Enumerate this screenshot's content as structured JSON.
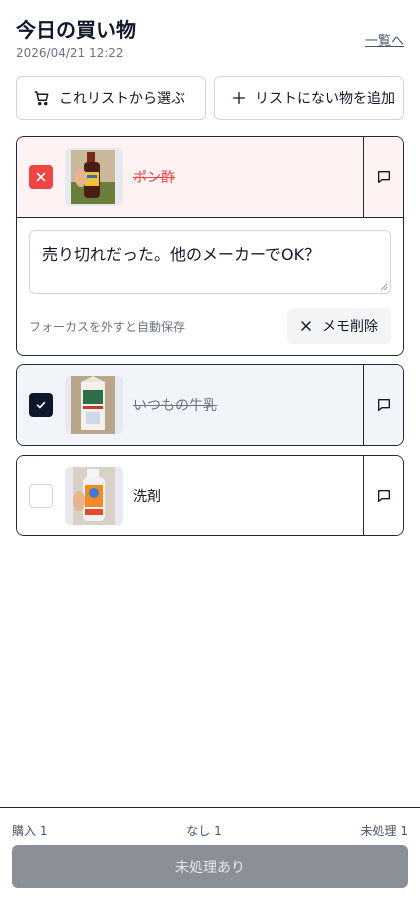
{
  "header": {
    "title": "今日の買い物",
    "datetime": "2026/04/21 12:22",
    "list_link": "一覧へ"
  },
  "actions": {
    "pick_label": "これリストから選ぶ",
    "pick_icon": "cart-icon",
    "add_label": "リストにない物を追加",
    "add_icon": "plus-icon"
  },
  "items": [
    {
      "name": "ポン酢",
      "status": "skip",
      "status_color": "#ef4444",
      "memo_open": true,
      "memo": {
        "text": "売り切れだった。他のメーカーでOK？",
        "hint": "フォーカスを外すと自動保存",
        "delete_label": "メモ削除"
      }
    },
    {
      "name": "いつもの牛乳",
      "status": "bought",
      "status_color": "#0f172a",
      "memo_open": false
    },
    {
      "name": "洗剤",
      "status": "pending",
      "memo_open": false
    }
  ],
  "footer": {
    "bought_count": "購入 1",
    "none_count": "なし 1",
    "pending_count": "未処理 1",
    "submit_label": "未処理あり"
  }
}
